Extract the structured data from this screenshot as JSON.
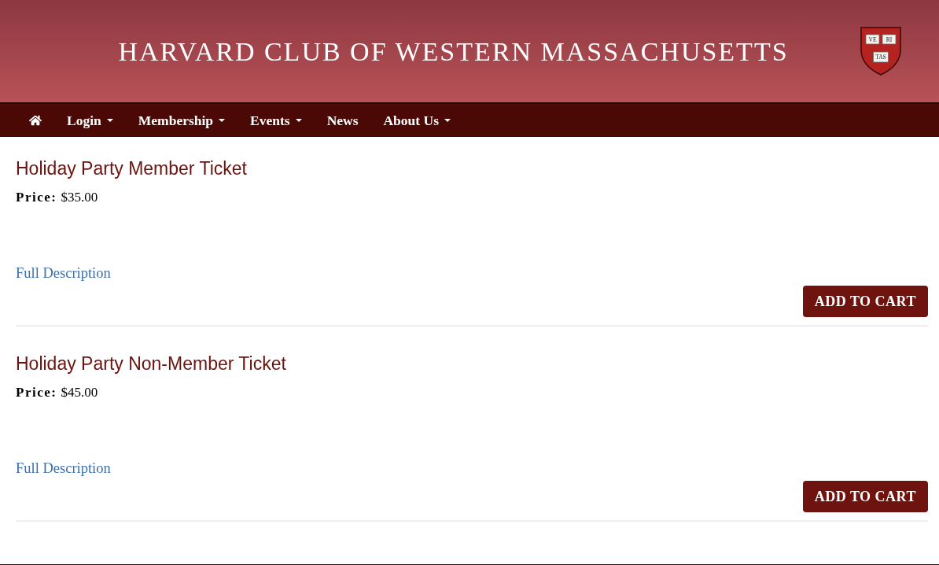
{
  "header": {
    "title": "HARVARD CLUB OF WESTERN MASSACHUSETTS",
    "crest": {
      "book_labels": [
        "VE",
        "RI",
        "TAS"
      ]
    }
  },
  "nav": {
    "items": [
      {
        "kind": "home"
      },
      {
        "kind": "link",
        "label": "Login",
        "dropdown": true
      },
      {
        "kind": "link",
        "label": "Membership",
        "dropdown": true
      },
      {
        "kind": "link",
        "label": "Events",
        "dropdown": true
      },
      {
        "kind": "link",
        "label": "News",
        "dropdown": false
      },
      {
        "kind": "link",
        "label": "About Us",
        "dropdown": true
      }
    ]
  },
  "products": [
    {
      "title": "Holiday Party Member Ticket",
      "price_label": "Price:",
      "price": "$35.00",
      "link": "Full Description",
      "button": "ADD TO CART"
    },
    {
      "title": "Holiday Party Non-Member Ticket",
      "price_label": "Price:",
      "price": "$45.00",
      "link": "Full Description",
      "button": "ADD TO CART"
    }
  ]
}
